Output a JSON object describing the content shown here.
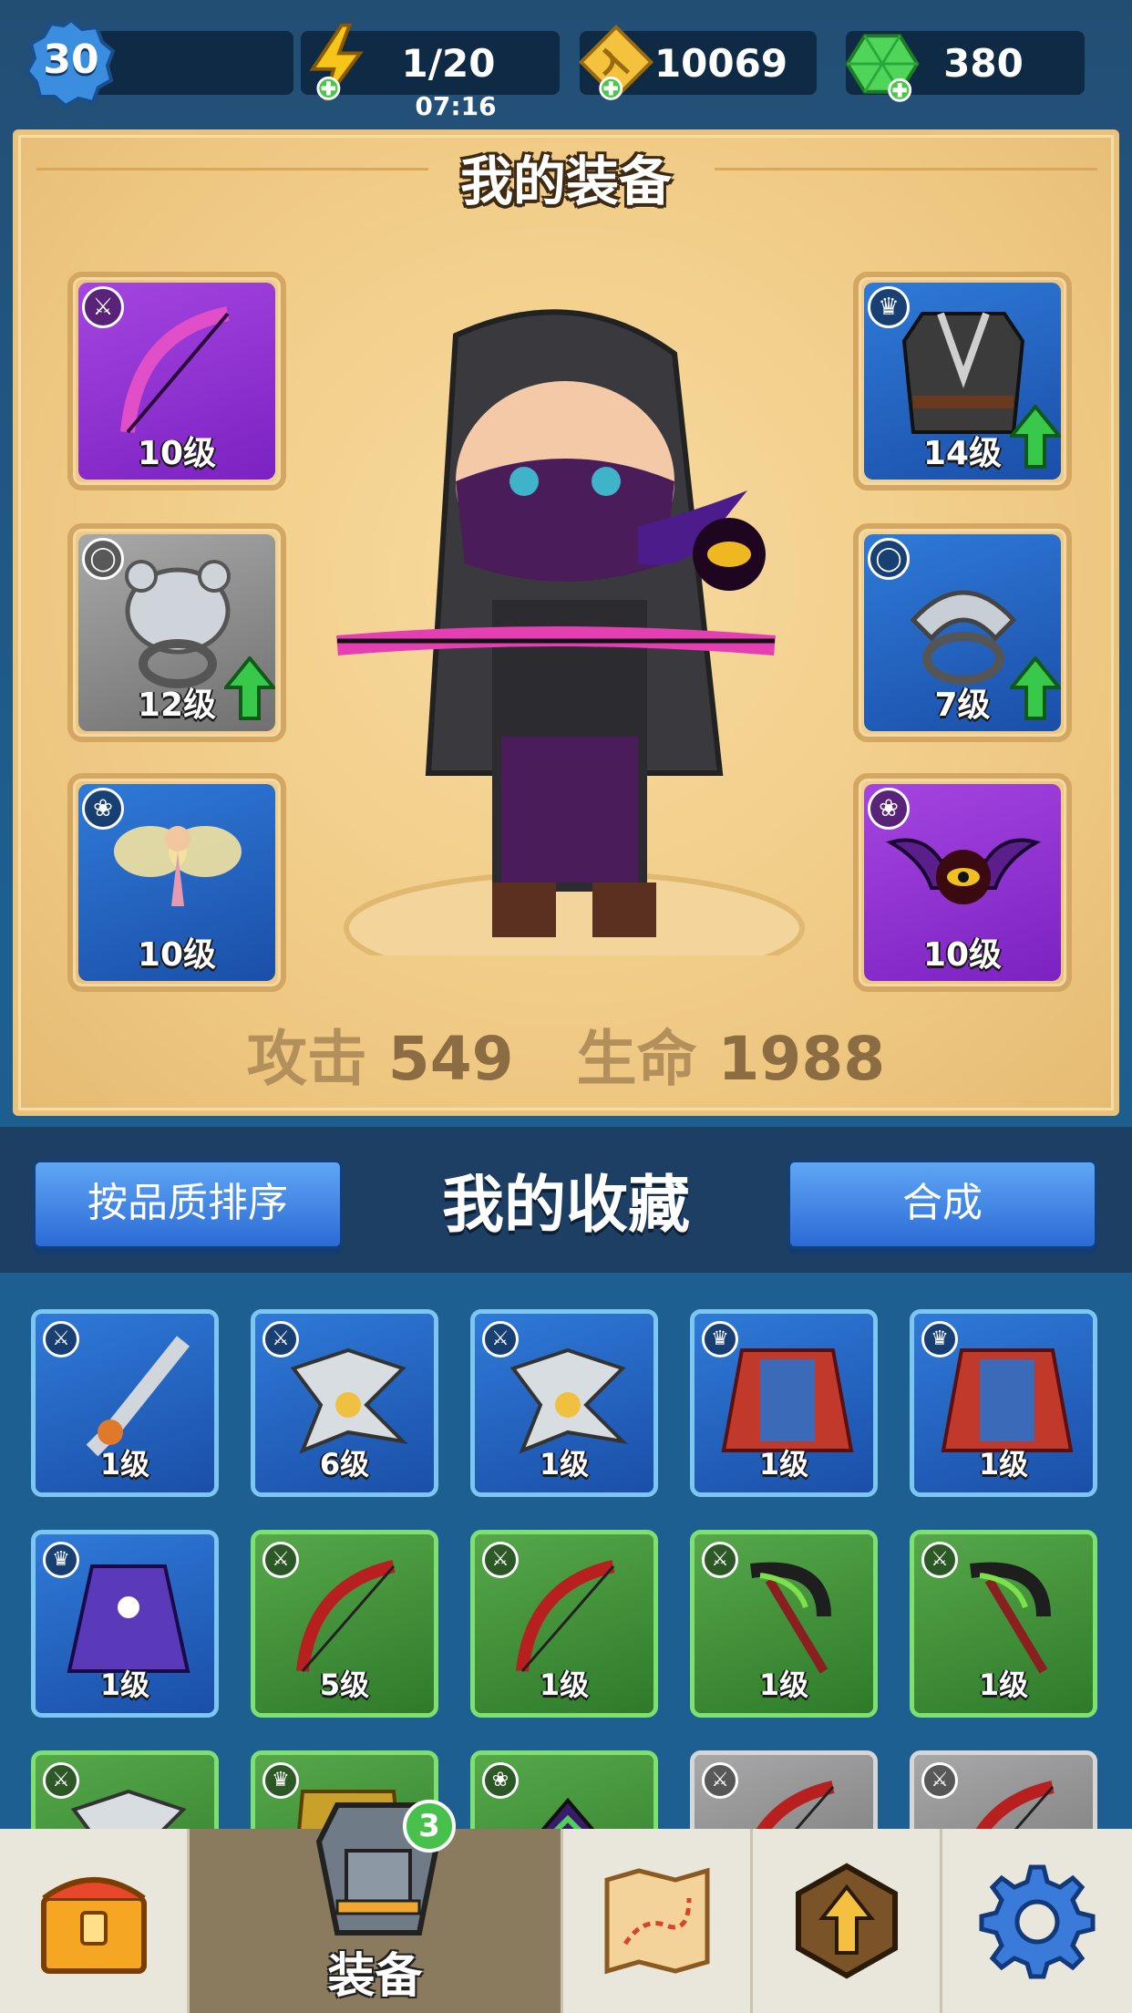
{
  "topbar": {
    "level": "30",
    "xp_progress": 0.1,
    "energy": "1/20",
    "energy_timer": "07:16",
    "coins": "10069",
    "gems": "380"
  },
  "equipment": {
    "title": "我的装备",
    "slots": [
      {
        "level": "10级",
        "rarity": "purple",
        "type_icon": "weapon-icon",
        "item": "bow",
        "upgrade": false
      },
      {
        "level": "12级",
        "rarity": "grey",
        "type_icon": "ring-icon",
        "item": "bear-ring",
        "upgrade": true
      },
      {
        "level": "10级",
        "rarity": "blue",
        "type_icon": "pet-icon",
        "item": "fairy",
        "upgrade": false
      },
      {
        "level": "14级",
        "rarity": "blue",
        "type_icon": "armor-icon",
        "item": "vest",
        "upgrade": true
      },
      {
        "level": "7级",
        "rarity": "blue",
        "type_icon": "ring-icon",
        "item": "serpent-ring",
        "upgrade": true
      },
      {
        "level": "10级",
        "rarity": "purple",
        "type_icon": "pet-icon",
        "item": "bat-eye",
        "upgrade": false
      }
    ],
    "stats": {
      "attack_label": "攻击",
      "attack_value": "549",
      "hp_label": "生命",
      "hp_value": "1988"
    }
  },
  "collection": {
    "title": "我的收藏",
    "sort_button": "按品质排序",
    "merge_button": "合成",
    "items": [
      {
        "level": "1级",
        "rarity": "blue",
        "type_icon": "weapon-icon",
        "item": "saw-sword"
      },
      {
        "level": "6级",
        "rarity": "blue",
        "type_icon": "weapon-icon",
        "item": "shuriken"
      },
      {
        "level": "1级",
        "rarity": "blue",
        "type_icon": "weapon-icon",
        "item": "shuriken"
      },
      {
        "level": "1级",
        "rarity": "blue",
        "type_icon": "armor-icon",
        "item": "cape"
      },
      {
        "level": "1级",
        "rarity": "blue",
        "type_icon": "armor-icon",
        "item": "cape"
      },
      {
        "level": "1级",
        "rarity": "blue",
        "type_icon": "armor-icon",
        "item": "robe"
      },
      {
        "level": "5级",
        "rarity": "green",
        "type_icon": "weapon-icon",
        "item": "red-bow"
      },
      {
        "level": "1级",
        "rarity": "green",
        "type_icon": "weapon-icon",
        "item": "red-bow"
      },
      {
        "level": "1级",
        "rarity": "green",
        "type_icon": "weapon-icon",
        "item": "scythe"
      },
      {
        "level": "1级",
        "rarity": "green",
        "type_icon": "weapon-icon",
        "item": "scythe"
      },
      {
        "level": "",
        "rarity": "green",
        "type_icon": "weapon-icon",
        "item": "shuriken"
      },
      {
        "level": "",
        "rarity": "green",
        "type_icon": "armor-icon",
        "item": "gold-armor"
      },
      {
        "level": "",
        "rarity": "green",
        "type_icon": "pet-icon",
        "item": "dark-pet"
      },
      {
        "level": "",
        "rarity": "grey",
        "type_icon": "weapon-icon",
        "item": "red-bow"
      },
      {
        "level": "",
        "rarity": "grey",
        "type_icon": "weapon-icon",
        "item": "red-bow"
      }
    ]
  },
  "nav": {
    "tabs": [
      {
        "name": "chest-tab",
        "icon": "treasure-chest-icon"
      },
      {
        "name": "equipment-tab",
        "icon": "armor-icon",
        "label": "装备",
        "badge": "3",
        "active": true
      },
      {
        "name": "map-tab",
        "icon": "map-icon"
      },
      {
        "name": "upgrade-tab",
        "icon": "upgrade-arrow-icon"
      },
      {
        "name": "settings-tab",
        "icon": "gear-icon"
      }
    ]
  },
  "colors": {
    "purple": "#8a2fd0",
    "blue": "#2460c0",
    "grey": "#8a8a8a",
    "green": "#3e8e36",
    "panel": "#efc983"
  }
}
